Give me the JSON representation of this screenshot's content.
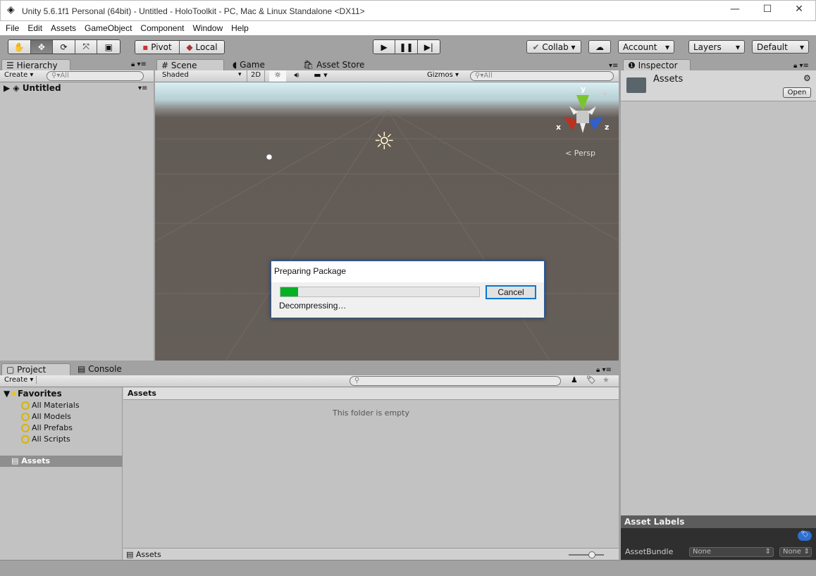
{
  "window": {
    "title": "Unity 5.6.1f1 Personal (64bit) - Untitled - HoloToolkit - PC, Mac & Linux Standalone <DX11>",
    "minimize": "—",
    "maximize": "☐",
    "close": "✕"
  },
  "menu": [
    "File",
    "Edit",
    "Assets",
    "GameObject",
    "Component",
    "Window",
    "Help"
  ],
  "toolbar": {
    "tools": [
      "hand",
      "move",
      "rotate",
      "scale",
      "rect"
    ],
    "active_tool": "move",
    "pivot": "Pivot",
    "local": "Local",
    "collab": "Collab",
    "account": "Account",
    "layers": "Layers",
    "layout": "Default"
  },
  "hierarchy": {
    "tab": "Hierarchy",
    "create": "Create",
    "search_placeholder": "All",
    "scene": "Untitled"
  },
  "scene": {
    "tabs": [
      "Scene",
      "Game",
      "Asset Store"
    ],
    "shading": "Shaded",
    "mode_2d": "2D",
    "gizmos": "Gizmos",
    "search_placeholder": "All",
    "projection": "Persp",
    "axes": {
      "x": "x",
      "y": "y",
      "z": "z"
    }
  },
  "dialog": {
    "title": "Preparing Package",
    "progress_percent": 9,
    "status": "Decompressing…",
    "cancel": "Cancel",
    "progress_color": "#06b025"
  },
  "inspector": {
    "tab": "Inspector",
    "asset": "Assets",
    "open": "Open",
    "labels_header": "Asset Labels",
    "assetbundle_label": "AssetBundle",
    "assetbundle_value": "None",
    "variant_value": "None"
  },
  "project": {
    "tabs": [
      "Project",
      "Console"
    ],
    "create": "Create",
    "favorites": "Favorites",
    "favorite_items": [
      "All Materials",
      "All Models",
      "All Prefabs",
      "All Scripts"
    ],
    "assets_root": "Assets",
    "header": "Assets",
    "empty": "This folder is empty",
    "footer_path": "Assets"
  }
}
